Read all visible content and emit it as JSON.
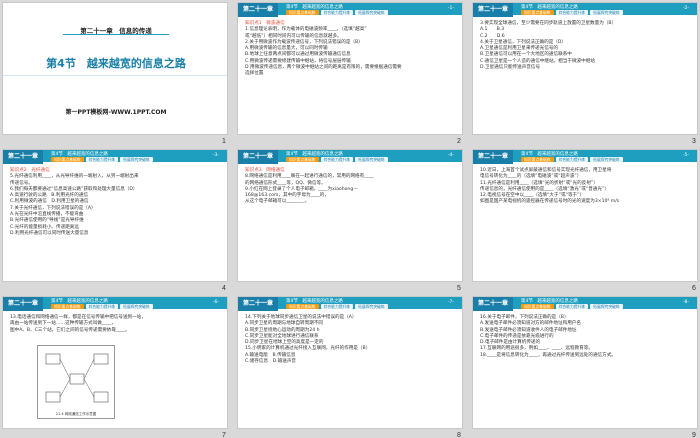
{
  "shared": {
    "chapter_badge": "第二十一章",
    "section_header": "第4节　越来越宽的信息之路",
    "tabs": [
      "知识要点基础练",
      "综合能力提升练",
      "拓展探究突破练"
    ]
  },
  "slides": [
    {
      "number": "1",
      "title": "第二十一章　信息的传递",
      "heading": "第4节　越来越宽的信息之路",
      "footer": "第一PPT模板网-WWW.1PPT.COM"
    },
    {
      "number": "2",
      "page": "-1-",
      "lines": [
        {
          "cls": "kp",
          "text": "知识点1　微波通信"
        },
        {
          "cls": "",
          "text": "1.信息理论表明，作为载体的电磁波频率____，（选填“越高”"
        },
        {
          "cls": "",
          "text": "或“越低”）相同时间内可以传输的信息就越多。"
        },
        {
          "cls": "",
          "text": "2.关于用微波作为载波传递信号，下列说法错误的是（B）"
        },
        {
          "cls": "",
          "text": "A.用微波传输的信息量大，可以同时传输"
        },
        {
          "cls": "",
          "text": "B.地球上任意两点间都可以通过用微波传输通信信息"
        },
        {
          "cls": "",
          "text": "C.用微波传递需要修建传输中继站，将信号层层传输"
        },
        {
          "cls": "",
          "text": "D.用微波传递信息，两个微波中继站之间的距离是有限的，需要根据通信需要"
        },
        {
          "cls": "",
          "text": "选择位置"
        }
      ]
    },
    {
      "number": "3",
      "page": "-2-",
      "lines": [
        {
          "cls": "",
          "text": "3.要实现全球通信，至少需要在同步轨道上放置的卫星数量为（B）"
        },
        {
          "cls": "",
          "text": "A.1　　B.3"
        },
        {
          "cls": "",
          "text": "C.2　　D.6"
        },
        {
          "cls": "",
          "text": "4.关于卫星通信，下列说法正确的是（D）"
        },
        {
          "cls": "",
          "text": "A.卫星通信是利用卫星来传递光信号的"
        },
        {
          "cls": "",
          "text": "B.卫星通信可以用在一个大地区的通信联系中"
        },
        {
          "cls": "",
          "text": "C.通信卫星是一个人造的通信中继站，相当于微波中继站"
        },
        {
          "cls": "",
          "text": "D.卫星通信只能传送声音信号"
        }
      ]
    },
    {
      "number": "4",
      "page": "-3-",
      "lines": [
        {
          "cls": "kp",
          "text": "知识点2　光纤通信"
        },
        {
          "cls": "",
          "text": "5.光纤通信利用____，从光导纤维的一端射入，从另一端射出来"
        },
        {
          "cls": "",
          "text": "传递信号。"
        },
        {
          "cls": "",
          "text": "6.我们每天都要通过“信息高速公路”获取和处理大量信息（D）"
        },
        {
          "cls": "",
          "text": "A.高速行驶的公路　B.利用光纤的通信"
        },
        {
          "cls": "",
          "text": "C.利用微波的通信　D.利用卫星的通信"
        },
        {
          "cls": "",
          "text": "7.关于光纤通信，下列说法错误的是（A）"
        },
        {
          "cls": "",
          "text": "A.光在光纤中沿直线传播，不能弯曲"
        },
        {
          "cls": "",
          "text": "B.光纤通信使用的“导线”是光导纤维"
        },
        {
          "cls": "",
          "text": "C.光纤的能量损耗小、传递距离远"
        },
        {
          "cls": "",
          "text": "D.利用光纤通信可以同时传送大量信息"
        }
      ]
    },
    {
      "number": "5",
      "page": "-4-",
      "lines": [
        {
          "cls": "kp",
          "text": "知识点3　网络通信"
        },
        {
          "cls": "",
          "text": "8.网络通信是利用____联在一起进行通信的，常用的网络有____"
        },
        {
          "cls": "",
          "text": "的网络通信形式____等，QQ、微信等。"
        },
        {
          "cls": "",
          "text": "9.小红在网上登录了个人电子邮箱，____为xiaohong—"
        },
        {
          "cls": "",
          "text": "168@163.com，其中的字母为____的，"
        },
        {
          "cls": "",
          "text": "从这个电子邮箱可以________。"
        }
      ]
    },
    {
      "number": "6",
      "page": "-5-",
      "lines": [
        {
          "cls": "",
          "text": "10.近日，上海首个试点屏蔽通信和信号实现光纤通信，用卫星将"
        },
        {
          "cls": "",
          "text": "电信号转化为____的（选填“电磁波”或“超声波”）"
        },
        {
          "cls": "",
          "text": "11.光纤通信是利用____（选填“光的折射”或“光的反射”）"
        },
        {
          "cls": "",
          "text": "传递信息的，光纤通信使用的是____（选填“激光”或“普通光”）"
        },
        {
          "cls": "",
          "text": "12.电视信号在空中以____（选填“大于”或“等于”）"
        },
        {
          "cls": "",
          "text": "如图是国产某电视机的遥控器在传递信号时的光的速度为3×10⁸ m/s"
        }
      ]
    },
    {
      "number": "7",
      "page": "-6-",
      "lines": [
        {
          "cls": "",
          "text": "13.电话通信和网络通信一样，都是在信号传输中把信号送到一站，"
        },
        {
          "cls": "",
          "text": "再由一站传送到下一站……这种传输方式叫做____，"
        },
        {
          "cls": "",
          "text": "图中A、B、C三个站，它们之间的信号传递需要依靠____。"
        }
      ],
      "diagram_caption": "21-4 网络通信工作示意图"
    },
    {
      "number": "8",
      "page": "-7-",
      "lines": [
        {
          "cls": "",
          "text": "14.下列关于地球同步通信卫星的说法中错误的是（A）"
        },
        {
          "cls": "",
          "text": "A.同步卫星的周期与地球自转周期不同"
        },
        {
          "cls": "",
          "text": "B.同步卫星绕地心运动的周期为24 h"
        },
        {
          "cls": "",
          "text": "C.同步卫星能对全地球进行通信联系"
        },
        {
          "cls": "",
          "text": "D.同步卫星在地球上空的高度是一定的"
        },
        {
          "cls": "",
          "text": "15.小明家的计算机通过光纤接入互联网，光纤的作用是（B）"
        },
        {
          "cls": "",
          "text": "A.输送电能　B.传输信息"
        },
        {
          "cls": "",
          "text": "C.储存信息　D.输送声音"
        }
      ]
    },
    {
      "number": "9",
      "page": "-8-",
      "lines": [
        {
          "cls": "",
          "text": "16.关于电子邮件，下列说法正确的是（B）"
        },
        {
          "cls": "",
          "text": "A.发送电子邮件必须知道对方的邮件地址和用户名"
        },
        {
          "cls": "",
          "text": "B.发送电子邮件必须知道收件人的电子邮件地址"
        },
        {
          "cls": "",
          "text": "C.电子邮件的传递是依靠光缆进行的"
        },
        {
          "cls": "",
          "text": "D.电子邮件是由计算机传递的"
        },
        {
          "cls": "",
          "text": "17.互联网的用途很多，例如____、____、远程教育等。"
        },
        {
          "cls": "",
          "text": "18.____是将信息转化为____，再通过光纤传送到远处的通信方式。"
        }
      ]
    }
  ]
}
